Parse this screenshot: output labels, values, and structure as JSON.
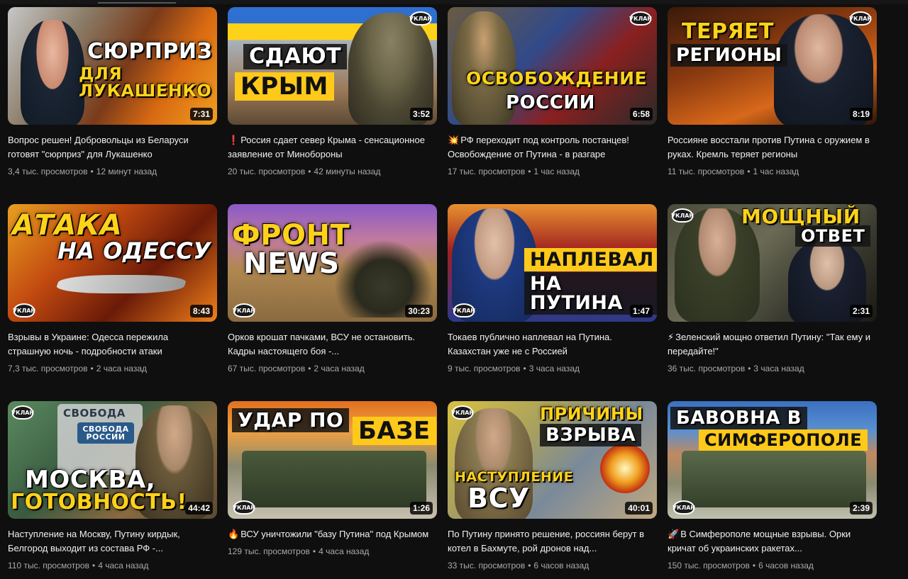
{
  "brand": "УКЛАН",
  "videos": [
    {
      "thumb_lines": [
        "СЮРПРИЗ",
        "ДЛЯ ЛУКАШЕНКО"
      ],
      "duration": "7:31",
      "emoji": "",
      "title": "Вопрос решен! Добровольцы из Беларуси готовят \"сюрприз\" для Лукашенко",
      "views": "3,4 тыс. просмотров",
      "age": "12 минут назад"
    },
    {
      "thumb_lines": [
        "СДАЮТ",
        "КРЫМ"
      ],
      "duration": "3:52",
      "emoji": "❗",
      "title": "Россия сдает север Крыма - сенсационное заявление от Минобороны",
      "views": "20 тыс. просмотров",
      "age": "42 минуты назад"
    },
    {
      "thumb_lines": [
        "ОСВОБОЖДЕНИЕ",
        "РОССИИ"
      ],
      "duration": "6:58",
      "emoji": "💥",
      "title": "РФ переходит под контроль постанцев! Освобождение от Путина - в разгаре",
      "views": "17 тыс. просмотров",
      "age": "1 час назад"
    },
    {
      "thumb_lines": [
        "ТЕРЯЕТ",
        "РЕГИОНЫ"
      ],
      "duration": "8:19",
      "emoji": "",
      "title": "Россияне восстали против Путина с оружием в руках. Кремль теряет регионы",
      "views": "11 тыс. просмотров",
      "age": "1 час назад"
    },
    {
      "thumb_lines": [
        "АТАКА",
        "НА ОДЕССУ"
      ],
      "duration": "8:43",
      "emoji": "",
      "title": "Взрывы в Украине: Одесса пережила страшную ночь - подробности атаки",
      "views": "7,3 тыс. просмотров",
      "age": "2 часа назад"
    },
    {
      "thumb_lines": [
        "ФРОНТ",
        "NEWS"
      ],
      "duration": "30:23",
      "emoji": "",
      "title": "Орков крошат пачками, ВСУ не остановить. Кадры настоящего боя -...",
      "views": "67 тыс. просмотров",
      "age": "2 часа назад"
    },
    {
      "thumb_lines": [
        "НАПЛЕВАЛ",
        "НА ПУТИНА"
      ],
      "duration": "1:47",
      "emoji": "",
      "title": "Токаев публично наплевал на Путина. Казахстан уже не с Россией",
      "views": "9 тыс. просмотров",
      "age": "3 часа назад"
    },
    {
      "thumb_lines": [
        "МОЩНЫЙ",
        "ОТВЕТ"
      ],
      "duration": "2:31",
      "emoji": "⚡",
      "title": "Зеленский мощно ответил Путину: \"Так ему и передайте!\"",
      "views": "36 тыс. просмотров",
      "age": "3 часа назад"
    },
    {
      "thumb_lines": [
        "МОСКВА,",
        "ГОТОВНОСТЬ!"
      ],
      "duration": "44:42",
      "emoji": "",
      "title": "Наступление на Москву, Путину кирдык, Белгород выходит из состава РФ -...",
      "views": "110 тыс. просмотров",
      "age": "4 часа назад"
    },
    {
      "thumb_lines": [
        "УДАР ПО",
        "БАЗЕ"
      ],
      "duration": "1:26",
      "emoji": "🔥",
      "title": "ВСУ уничтожили \"базу Путина\" под Крымом",
      "views": "129 тыс. просмотров",
      "age": "4 часа назад"
    },
    {
      "thumb_lines": [
        "ПРИЧИНЫ",
        "ВЗРЫВА",
        "НАСТУПЛЕНИЕ",
        "ВСУ"
      ],
      "duration": "40:01",
      "emoji": "",
      "title": "По Путину принято решение, россиян берут в котел в Бахмуте, рой дронов над...",
      "views": "33 тыс. просмотров",
      "age": "6 часов назад"
    },
    {
      "thumb_lines": [
        "БАВОВНА В",
        "СИМФЕРОПОЛЕ"
      ],
      "duration": "2:39",
      "emoji": "🚀",
      "title": "В Симферополе мощные взрывы. Орки кричат об украинских ракетах...",
      "views": "150 тыс. просмотров",
      "age": "6 часов назад"
    }
  ],
  "thumb_extra": {
    "flag_text": "СВОБОДА РОССИИ",
    "flag_small": "СВОБОДА"
  }
}
